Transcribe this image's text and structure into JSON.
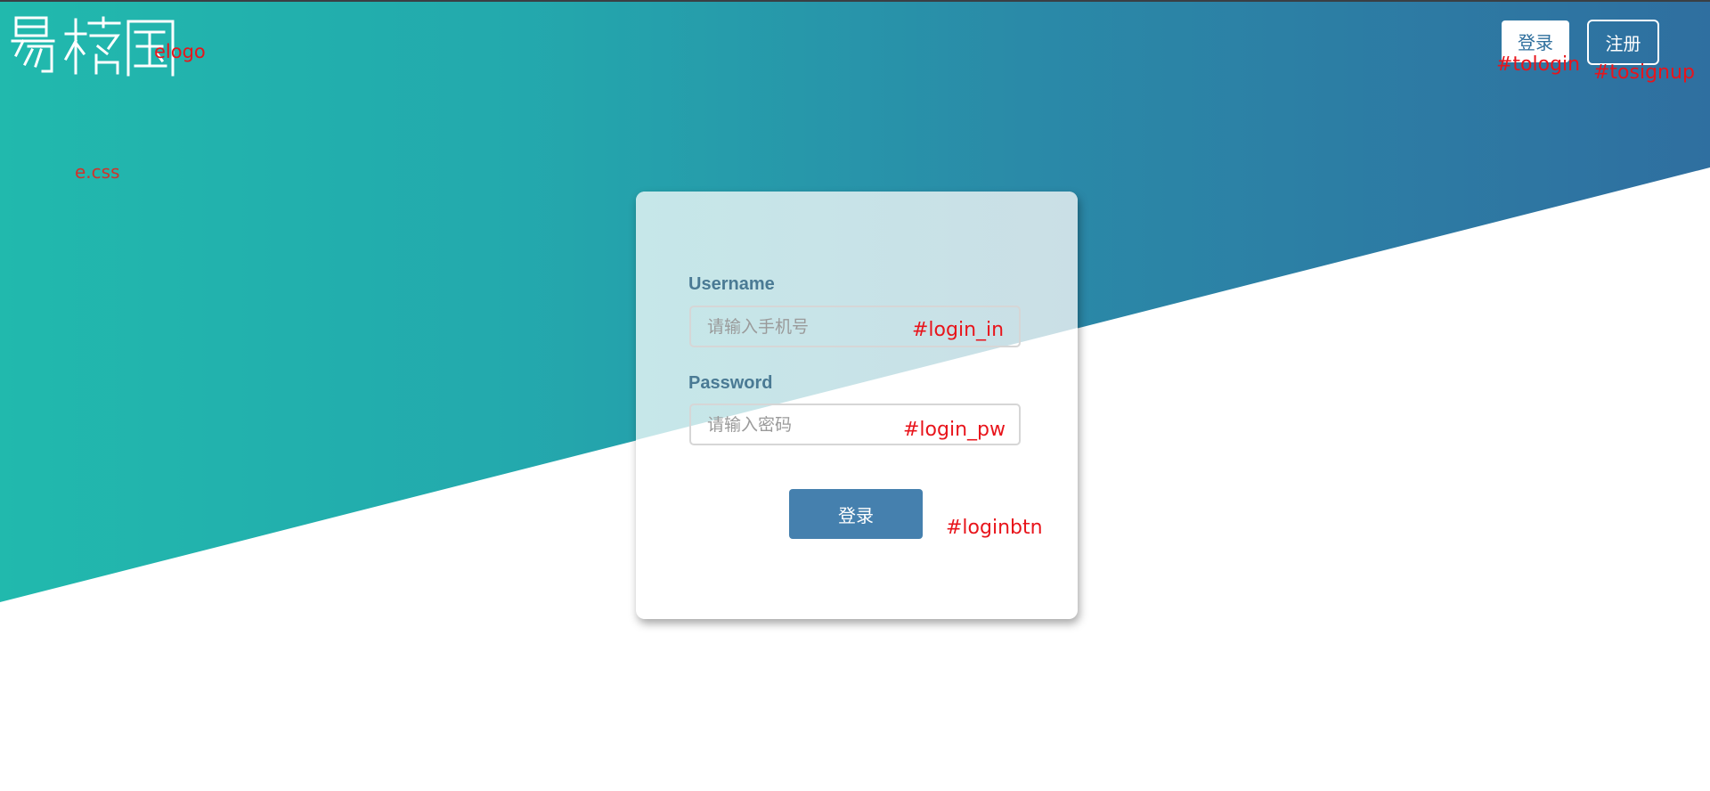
{
  "header": {
    "logo_text": "易梓园",
    "login_label": "登录",
    "signup_label": "注册"
  },
  "annotations": {
    "logo": "elogo",
    "css": "e.css",
    "tologin": "#tologin",
    "tosignup": "#tosignup",
    "login_in": "#login_in",
    "login_pw": "#login_pw",
    "loginbtn": "#loginbtn"
  },
  "login_form": {
    "username_label": "Username",
    "username_placeholder": "请输入手机号",
    "password_label": "Password",
    "password_placeholder": "请输入密码",
    "submit_label": "登录"
  },
  "colors": {
    "gradient_start": "#21b9ad",
    "gradient_end": "#2f6fa0",
    "button_blue": "#4580ae",
    "label_color": "#4a7a94",
    "annotation_red": "#e8141b"
  }
}
